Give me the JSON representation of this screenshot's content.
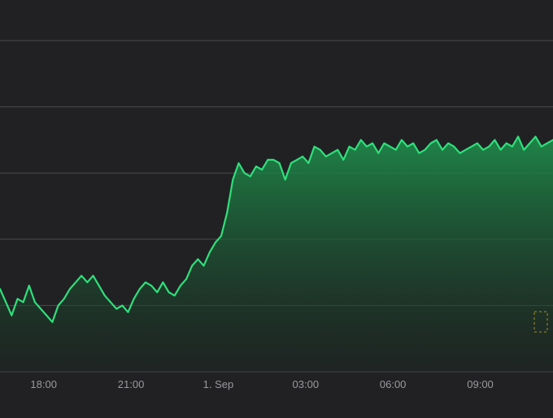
{
  "theme": {
    "background": "#212124",
    "grid_color": "#4a4a4e",
    "line_color": "#2fe07a",
    "fill_top": "#1f8a4a",
    "fill_bottom": "#1a2a20",
    "tick_color": "#9a9a9e",
    "watermark_color": "#9a8a1e"
  },
  "chart_data": {
    "type": "area",
    "title": "",
    "xlabel": "",
    "ylabel": "",
    "grid": true,
    "legend": "none",
    "x_ticks": [
      "18:00",
      "21:00",
      "1. Sep",
      "03:00",
      "06:00",
      "09:00"
    ],
    "x_tick_hours": [
      18,
      21,
      24,
      27,
      30,
      33
    ],
    "xlim": [
      16.5,
      35.5
    ],
    "ylim": [
      0,
      5
    ],
    "gridlines_y": [
      1,
      2,
      3,
      4,
      5
    ],
    "series": [
      {
        "x": [
          16.5,
          16.7,
          16.9,
          17.1,
          17.3,
          17.5,
          17.7,
          17.9,
          18.1,
          18.3,
          18.5,
          18.7,
          18.9,
          19.1,
          19.3,
          19.5,
          19.7,
          19.9,
          20.1,
          20.3,
          20.5,
          20.7,
          20.9,
          21.1,
          21.3,
          21.5,
          21.7,
          21.9,
          22.1,
          22.3,
          22.5,
          22.7,
          22.9,
          23.1,
          23.3,
          23.5,
          23.7,
          23.9,
          24.1,
          24.3,
          24.5,
          24.7,
          24.9,
          25.1,
          25.3,
          25.5,
          25.7,
          25.9,
          26.1,
          26.3,
          26.5,
          26.7,
          26.9,
          27.1,
          27.3,
          27.5,
          27.7,
          27.9,
          28.1,
          28.3,
          28.5,
          28.7,
          28.9,
          29.1,
          29.3,
          29.5,
          29.7,
          29.9,
          30.1,
          30.3,
          30.5,
          30.7,
          30.9,
          31.1,
          31.3,
          31.5,
          31.7,
          31.9,
          32.1,
          32.3,
          32.5,
          32.7,
          32.9,
          33.1,
          33.3,
          33.5,
          33.7,
          33.9,
          34.1,
          34.3,
          34.5,
          34.7,
          34.9,
          35.1,
          35.3,
          35.5
        ],
        "values": [
          1.25,
          1.05,
          0.85,
          1.1,
          1.05,
          1.3,
          1.05,
          0.95,
          0.85,
          0.75,
          1.0,
          1.1,
          1.25,
          1.35,
          1.45,
          1.35,
          1.45,
          1.3,
          1.15,
          1.05,
          0.95,
          1.0,
          0.9,
          1.1,
          1.25,
          1.35,
          1.3,
          1.2,
          1.35,
          1.2,
          1.15,
          1.3,
          1.4,
          1.6,
          1.7,
          1.6,
          1.8,
          1.95,
          2.05,
          2.4,
          2.9,
          3.15,
          3.0,
          2.95,
          3.1,
          3.05,
          3.2,
          3.2,
          3.15,
          2.9,
          3.15,
          3.2,
          3.25,
          3.15,
          3.4,
          3.35,
          3.25,
          3.3,
          3.35,
          3.2,
          3.4,
          3.35,
          3.5,
          3.4,
          3.45,
          3.3,
          3.45,
          3.4,
          3.35,
          3.5,
          3.4,
          3.45,
          3.3,
          3.35,
          3.45,
          3.5,
          3.35,
          3.45,
          3.4,
          3.3,
          3.35,
          3.4,
          3.45,
          3.35,
          3.4,
          3.5,
          3.35,
          3.45,
          3.4,
          3.55,
          3.35,
          3.45,
          3.55,
          3.4,
          3.45,
          3.5
        ]
      }
    ]
  }
}
